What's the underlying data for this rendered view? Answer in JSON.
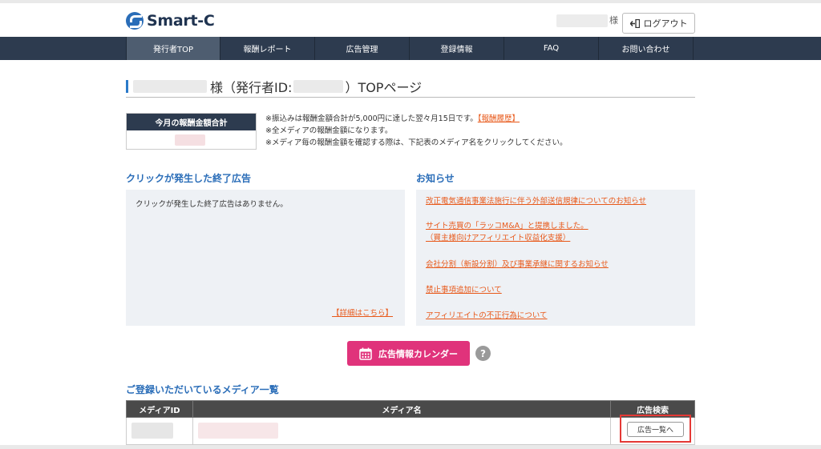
{
  "header": {
    "logo_text": "Smart-C",
    "user_suffix": "様",
    "logout_label": "ログアウト"
  },
  "nav": {
    "items": [
      {
        "label": "発行者TOP",
        "active": true
      },
      {
        "label": "報酬レポート"
      },
      {
        "label": "広告管理"
      },
      {
        "label": "登録情報"
      },
      {
        "label": "FAQ"
      },
      {
        "label": "お問い合わせ"
      }
    ]
  },
  "page": {
    "title_part1": "様（発行者ID:",
    "title_part2": "）TOPページ"
  },
  "monthly": {
    "heading": "今月の報酬金額合計"
  },
  "notes": {
    "line1": "※振込みは報酬金額合計が5,000円に達した翌々月15日です。",
    "line1_link": "【報酬履歴】",
    "line2": "※全メディアの報酬金額になります。",
    "line3": "※メディア毎の報酬金額を確認する際は、下記表のメディア名をクリックしてください。"
  },
  "ended_ads": {
    "heading": "クリックが発生した終了広告",
    "empty_message": "クリックが発生した終了広告はありません。",
    "detail_link": "【詳細はこちら】"
  },
  "news": {
    "heading": "お知らせ",
    "items": [
      {
        "line1": "改正電気通信事業法施行に伴う外部送信規律についてのお知らせ"
      },
      {
        "line1": "サイト売買の「ラッコM&A」と提携しました。",
        "line2": "（買主様向けアフィリエイト収益化支援）"
      },
      {
        "line1": "会社分割（新設分割）及び事業承継に関するお知らせ"
      },
      {
        "line1": "禁止事項追加について"
      },
      {
        "line1": "アフィリエイトの不正行為について"
      }
    ]
  },
  "calendar": {
    "label": "広告情報カレンダー",
    "help": "?"
  },
  "media": {
    "heading": "ご登録いただいているメディア一覧",
    "columns": [
      "メディアID",
      "メディア名",
      "広告検索"
    ],
    "button_label": "広告一覧へ"
  },
  "colors": {
    "nav_bg": "#2d3b4f",
    "accent_blue": "#2a6db8",
    "link_orange": "#e8591a",
    "calendar_pink": "#e0337b",
    "highlight_red": "#e53935"
  }
}
